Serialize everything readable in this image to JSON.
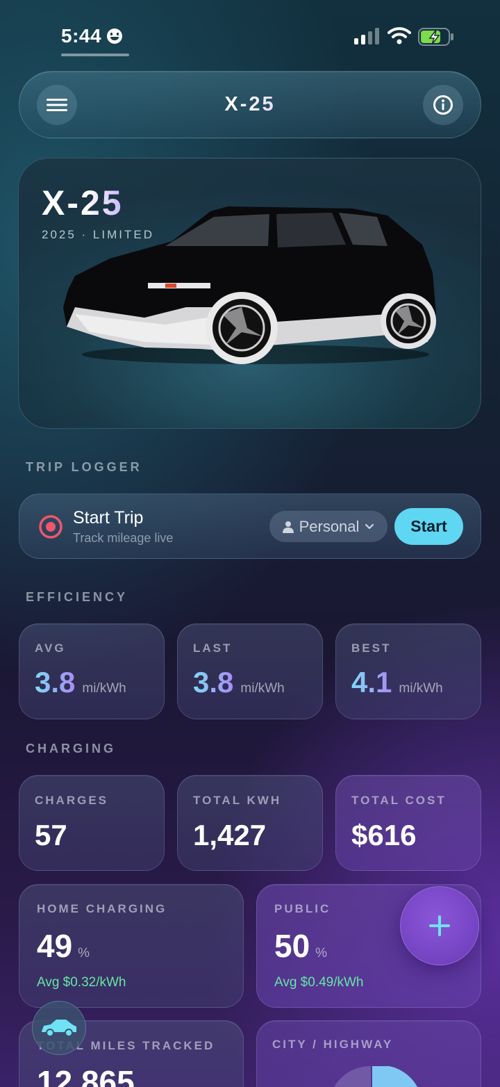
{
  "status_bar": {
    "time": "5:44"
  },
  "header": {
    "title": "X-25",
    "menu_icon": "hamburger-icon",
    "info_icon": "info-icon"
  },
  "hero": {
    "model": "X-25",
    "subtitle": "2025 · LIMITED"
  },
  "trip_logger": {
    "section_label": "TRIP LOGGER",
    "title": "Start Trip",
    "subtitle": "Track mileage live",
    "mode": "Personal",
    "start_label": "Start"
  },
  "efficiency": {
    "section_label": "EFFICIENCY",
    "cards": [
      {
        "label": "AVG",
        "value": "3.8",
        "unit": "mi/kWh"
      },
      {
        "label": "LAST",
        "value": "3.8",
        "unit": "mi/kWh"
      },
      {
        "label": "BEST",
        "value": "4.1",
        "unit": "mi/kWh"
      }
    ]
  },
  "charging": {
    "section_label": "CHARGING",
    "cards": [
      {
        "label": "CHARGES",
        "value": "57"
      },
      {
        "label": "TOTAL KWH",
        "value": "1,427"
      },
      {
        "label": "TOTAL COST",
        "value": "$616"
      }
    ],
    "split": [
      {
        "label": "HOME CHARGING",
        "value": "49",
        "unit": "%",
        "avg": "Avg $0.32/kWh"
      },
      {
        "label": "PUBLIC",
        "value": "50",
        "unit": "%",
        "avg": "Avg $0.49/kWh"
      }
    ]
  },
  "bottom": {
    "miles_label": "TOTAL MILES TRACKED",
    "miles_value": "12,865",
    "city_highway_label": "CITY / HIGHWAY"
  },
  "colors": {
    "accent_cyan": "#5fd6f2",
    "accent_purple": "#7b48c8",
    "record_red": "#f0566b",
    "green": "#67e6a5"
  }
}
